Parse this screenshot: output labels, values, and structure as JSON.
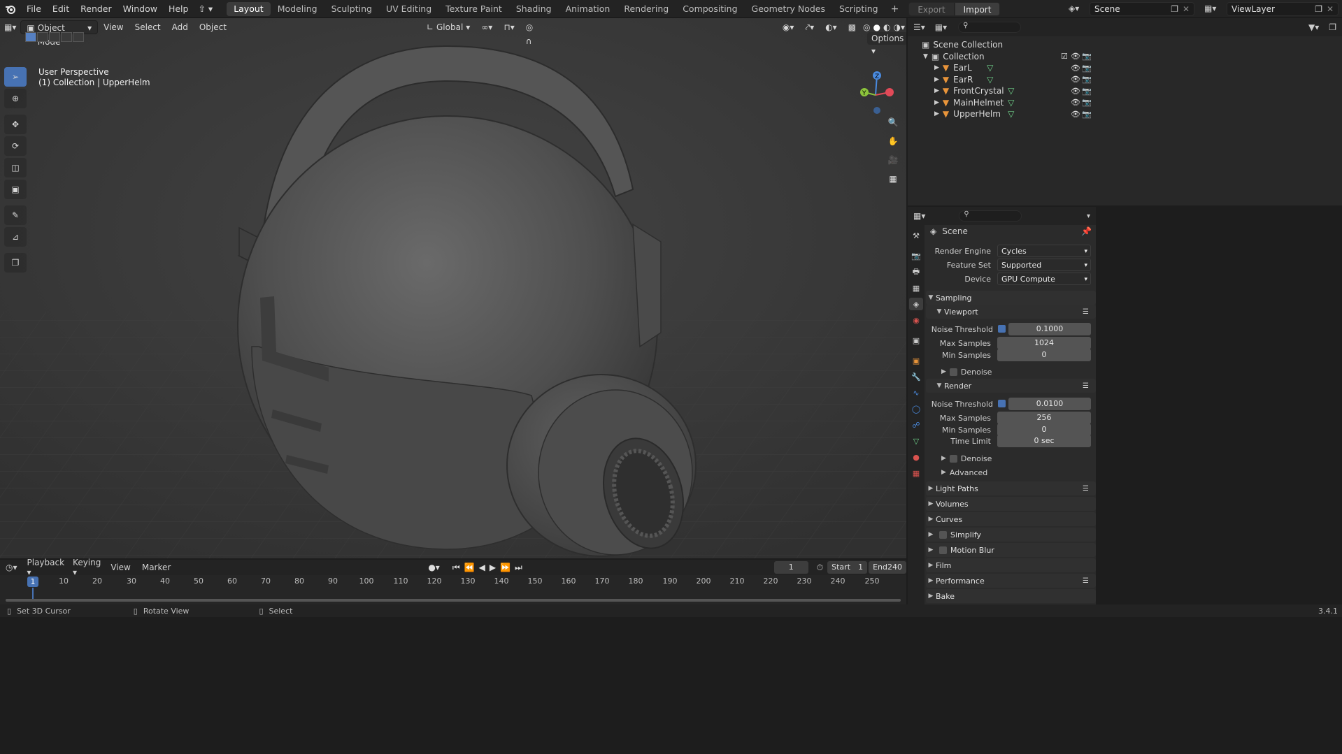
{
  "topbar": {
    "menus": [
      "File",
      "Edit",
      "Render",
      "Window",
      "Help"
    ],
    "workspaces": [
      "Layout",
      "Modeling",
      "Sculpting",
      "UV Editing",
      "Texture Paint",
      "Shading",
      "Animation",
      "Rendering",
      "Compositing",
      "Geometry Nodes",
      "Scripting"
    ],
    "active_workspace": "Layout",
    "export_label": "Export",
    "import_label": "Import",
    "scene_name": "Scene",
    "view_layer": "ViewLayer"
  },
  "viewport": {
    "mode": "Object Mode",
    "menus": [
      "View",
      "Select",
      "Add",
      "Object"
    ],
    "orientation": "Global",
    "options_label": "Options",
    "info_line1": "User Perspective",
    "info_line2": "(1) Collection | UpperHelm",
    "gizmo_z": "Z",
    "gizmo_y": "Y"
  },
  "outliner": {
    "scene_collection": "Scene Collection",
    "collection": "Collection",
    "objects": [
      "EarL",
      "EarR",
      "FrontCrystal",
      "MainHelmet",
      "UpperHelm"
    ]
  },
  "properties": {
    "context": "Scene",
    "render_engine_label": "Render Engine",
    "render_engine": "Cycles",
    "feature_set_label": "Feature Set",
    "feature_set": "Supported",
    "device_label": "Device",
    "device": "GPU Compute",
    "sampling": "Sampling",
    "viewport": "Viewport",
    "noise_threshold_label": "Noise Threshold",
    "vp_noise_threshold": "0.1000",
    "max_samples_label": "Max Samples",
    "vp_max_samples": "1024",
    "min_samples_label": "Min Samples",
    "vp_min_samples": "0",
    "denoise": "Denoise",
    "render": "Render",
    "r_noise_threshold": "0.0100",
    "r_max_samples": "256",
    "r_min_samples": "0",
    "time_limit_label": "Time Limit",
    "time_limit": "0 sec",
    "advanced": "Advanced",
    "light_paths": "Light Paths",
    "volumes": "Volumes",
    "curves": "Curves",
    "simplify": "Simplify",
    "motion_blur": "Motion Blur",
    "film": "Film",
    "performance": "Performance",
    "bake": "Bake"
  },
  "timeline": {
    "menus": [
      "Playback",
      "Keying",
      "View",
      "Marker"
    ],
    "current_frame": "1",
    "start_label": "Start",
    "start": "1",
    "end_label": "End",
    "end": "240",
    "ruler": [
      "1",
      "10",
      "20",
      "30",
      "40",
      "50",
      "60",
      "70",
      "80",
      "90",
      "100",
      "110",
      "120",
      "130",
      "140",
      "150",
      "160",
      "170",
      "180",
      "190",
      "200",
      "210",
      "220",
      "230",
      "240",
      "250"
    ]
  },
  "status": {
    "hint1": "Set 3D Cursor",
    "hint2": "Rotate View",
    "hint3": "Select",
    "version": "3.4.1"
  },
  "colors": {
    "accent": "#4772b3",
    "object_icon": "#e8943a",
    "mesh_icon": "#6fd28a"
  }
}
